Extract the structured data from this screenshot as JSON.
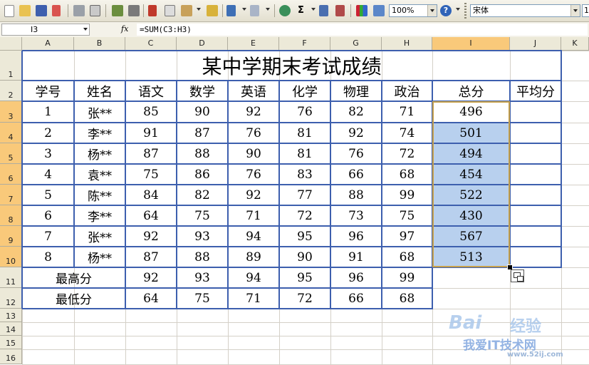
{
  "toolbar": {
    "zoom": "100%",
    "font_name": "宋体",
    "font_size": "1",
    "sum_symbol": "Σ",
    "help_symbol": "?"
  },
  "formula_bar": {
    "cell_ref": "I3",
    "fx": "fx",
    "formula": "=SUM(C3:H3)"
  },
  "columns": [
    "A",
    "B",
    "C",
    "D",
    "E",
    "F",
    "G",
    "H",
    "I",
    "J",
    "K"
  ],
  "rows": [
    "1",
    "2",
    "3",
    "4",
    "5",
    "6",
    "7",
    "8",
    "9",
    "10",
    "11",
    "12",
    "13",
    "14",
    "15",
    "16"
  ],
  "sheet": {
    "title": "某中学期末考试成绩",
    "headers": [
      "学号",
      "姓名",
      "语文",
      "数学",
      "英语",
      "化学",
      "物理",
      "政治",
      "总分",
      "平均分"
    ],
    "students": [
      {
        "id": "1",
        "name": "张**",
        "scores": [
          "85",
          "90",
          "92",
          "76",
          "82",
          "71"
        ],
        "total": "496"
      },
      {
        "id": "2",
        "name": "李**",
        "scores": [
          "91",
          "87",
          "76",
          "81",
          "92",
          "74"
        ],
        "total": "501"
      },
      {
        "id": "3",
        "name": "杨**",
        "scores": [
          "87",
          "88",
          "90",
          "81",
          "76",
          "72"
        ],
        "total": "494"
      },
      {
        "id": "4",
        "name": "袁**",
        "scores": [
          "75",
          "86",
          "76",
          "83",
          "66",
          "68"
        ],
        "total": "454"
      },
      {
        "id": "5",
        "name": "陈**",
        "scores": [
          "84",
          "82",
          "92",
          "77",
          "88",
          "99"
        ],
        "total": "522"
      },
      {
        "id": "6",
        "name": "李**",
        "scores": [
          "64",
          "75",
          "71",
          "72",
          "73",
          "75"
        ],
        "total": "430"
      },
      {
        "id": "7",
        "name": "张**",
        "scores": [
          "92",
          "93",
          "94",
          "95",
          "96",
          "97"
        ],
        "total": "567"
      },
      {
        "id": "8",
        "name": "杨**",
        "scores": [
          "87",
          "88",
          "89",
          "90",
          "91",
          "68"
        ],
        "total": "513"
      }
    ],
    "max_label": "最高分",
    "max_values": [
      "92",
      "93",
      "94",
      "95",
      "96",
      "99"
    ],
    "min_label": "最低分",
    "min_values": [
      "64",
      "75",
      "71",
      "72",
      "66",
      "68"
    ]
  },
  "watermark": {
    "brand": "Bai",
    "brand2": "经验",
    "site_cn": "我爱IT技术网",
    "site_url": "www.52ij.com"
  },
  "colors": {
    "border": "#3d5fae",
    "selection_fill": "#b8d0ee",
    "selection_border": "#c8a24c",
    "header_active": "#f9c97a"
  }
}
